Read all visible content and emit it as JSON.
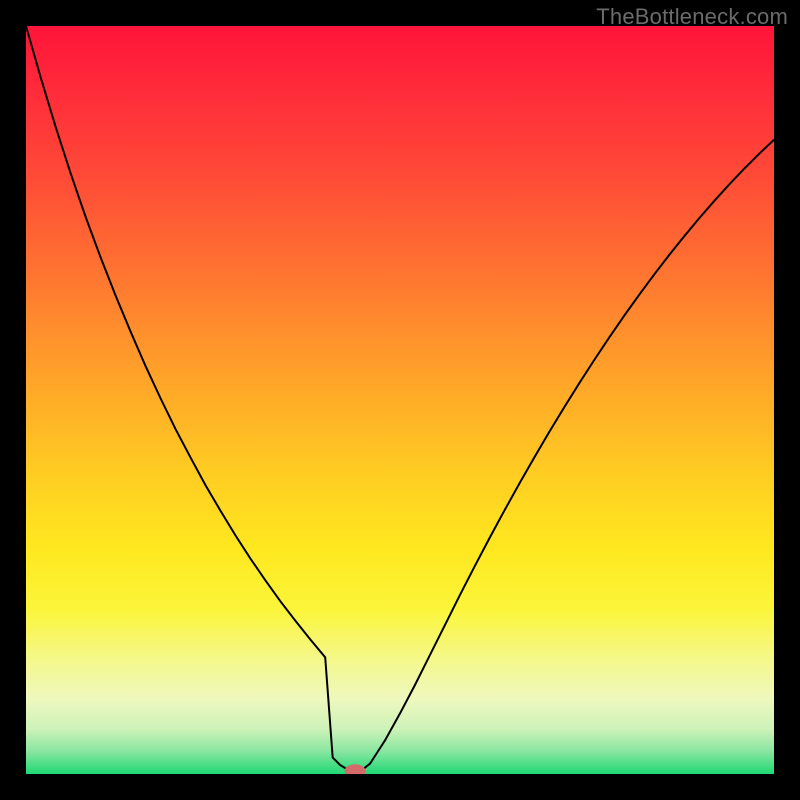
{
  "watermark": "TheBottleneck.com",
  "chart_data": {
    "type": "line",
    "title": "",
    "xlabel": "",
    "ylabel": "",
    "xlim": [
      0,
      100
    ],
    "ylim": [
      0,
      100
    ],
    "x": [
      0,
      2,
      4,
      6,
      8,
      10,
      12,
      14,
      16,
      18,
      20,
      22,
      24,
      26,
      28,
      30,
      32,
      34,
      36,
      38,
      40,
      41,
      42,
      43,
      44,
      45,
      46,
      48,
      50,
      52,
      54,
      56,
      58,
      60,
      62,
      64,
      66,
      68,
      70,
      72,
      74,
      76,
      78,
      80,
      82,
      84,
      86,
      88,
      90,
      92,
      94,
      96,
      98,
      100
    ],
    "values": [
      100.0,
      93.0,
      86.4,
      80.2,
      74.4,
      69.0,
      63.9,
      59.1,
      54.5,
      50.2,
      46.1,
      42.3,
      38.6,
      35.2,
      31.9,
      28.8,
      25.9,
      23.1,
      20.5,
      18.0,
      15.6,
      2.2,
      1.2,
      0.6,
      0.4,
      0.6,
      1.4,
      4.5,
      8.1,
      11.9,
      15.9,
      19.9,
      23.9,
      27.8,
      31.6,
      35.3,
      38.9,
      42.4,
      45.8,
      49.1,
      52.3,
      55.4,
      58.4,
      61.3,
      64.1,
      66.8,
      69.4,
      71.9,
      74.3,
      76.6,
      78.8,
      80.9,
      82.9,
      84.8
    ],
    "marker": {
      "x": 44,
      "y": 0.4,
      "color": "#d46a6a"
    },
    "background_gradient": {
      "stops": [
        {
          "offset": 0.0,
          "color": "#ff143a"
        },
        {
          "offset": 0.1,
          "color": "#ff2f3a"
        },
        {
          "offset": 0.2,
          "color": "#ff4a37"
        },
        {
          "offset": 0.3,
          "color": "#ff6a32"
        },
        {
          "offset": 0.4,
          "color": "#ff8c2d"
        },
        {
          "offset": 0.5,
          "color": "#ffad27"
        },
        {
          "offset": 0.6,
          "color": "#ffcd22"
        },
        {
          "offset": 0.7,
          "color": "#ffe81f"
        },
        {
          "offset": 0.78,
          "color": "#fbf53a"
        },
        {
          "offset": 0.85,
          "color": "#f4f88e"
        },
        {
          "offset": 0.9,
          "color": "#eef8be"
        },
        {
          "offset": 0.94,
          "color": "#cdf2b8"
        },
        {
          "offset": 0.97,
          "color": "#88e6a0"
        },
        {
          "offset": 1.0,
          "color": "#1fd873"
        }
      ]
    }
  }
}
